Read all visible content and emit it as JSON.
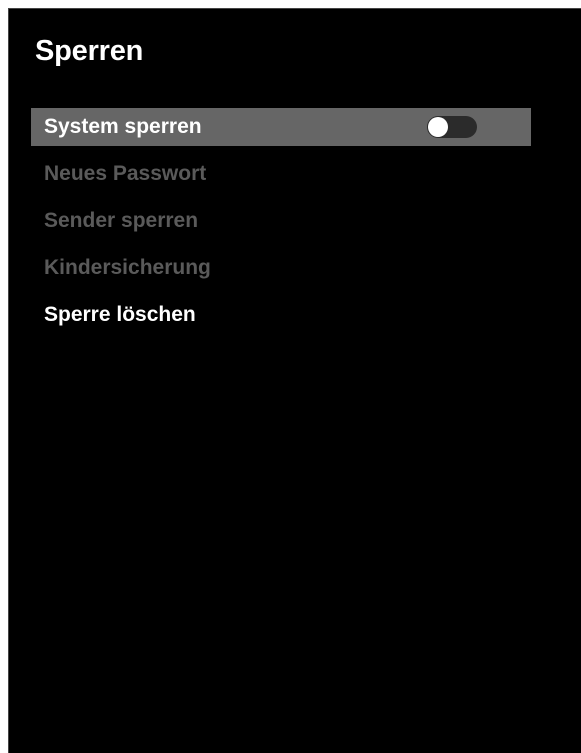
{
  "screen": {
    "title": "Sperren"
  },
  "menu": {
    "items": [
      {
        "label": "System sperren",
        "state": "selected",
        "toggle": "off"
      },
      {
        "label": "Neues Passwort",
        "state": "disabled"
      },
      {
        "label": "Sender sperren",
        "state": "disabled"
      },
      {
        "label": "Kindersicherung",
        "state": "disabled"
      },
      {
        "label": "Sperre löschen",
        "state": "enabled"
      }
    ]
  },
  "colors": {
    "background": "#000000",
    "selected_bar": "#666666",
    "disabled_text": "#5a5a5a",
    "enabled_text": "#ffffff",
    "toggle_track": "#2b2b2b",
    "toggle_knob": "#ffffff"
  }
}
